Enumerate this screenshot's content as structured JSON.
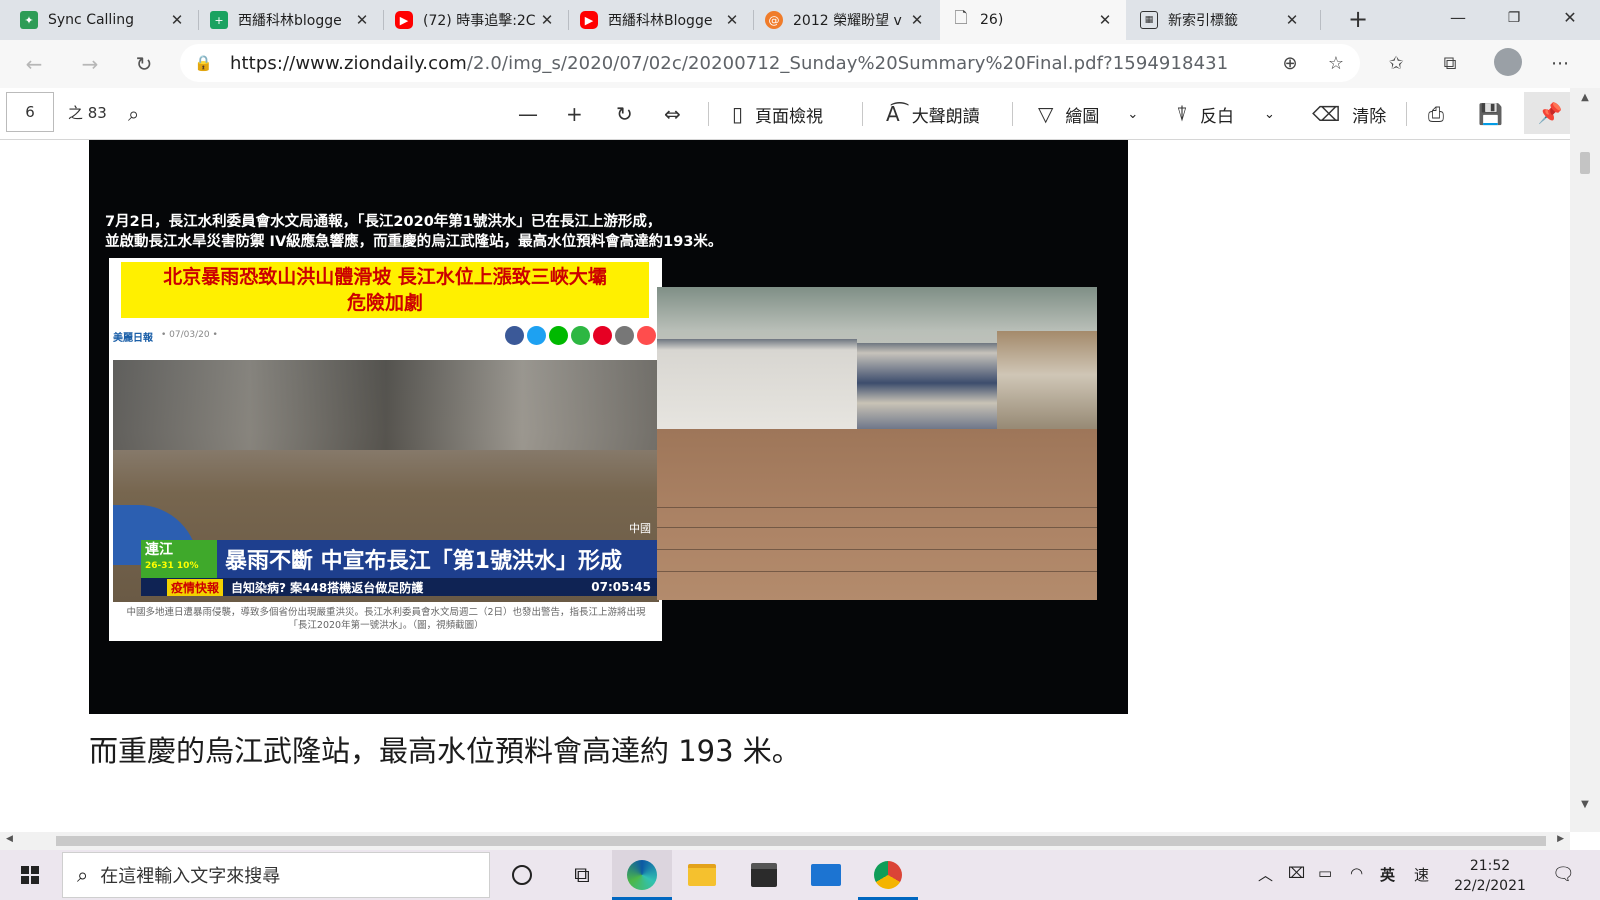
{
  "tabs": [
    {
      "title": "Sync Calling",
      "icon": "sync-calling-favicon",
      "color": "#2e9c56"
    },
    {
      "title": "西繙科林blogge",
      "icon": "blogger-plus-favicon",
      "color": "#1aa260"
    },
    {
      "title": "(72) 時事追擊:2C",
      "icon": "youtube-favicon",
      "color": "#ff0000"
    },
    {
      "title": "西繙科林Blogge",
      "icon": "youtube-favicon",
      "color": "#ff0000"
    },
    {
      "title": "2012 榮耀盼望 v",
      "icon": "orange-swirl-favicon",
      "color": "#f07c2a"
    },
    {
      "title": "26)",
      "icon": "document-icon",
      "color": "#555555"
    },
    {
      "title": "新索引標籤",
      "icon": "new-tab-icon",
      "color": "#333333"
    }
  ],
  "address": {
    "host": "https://www.ziondaily.com",
    "path": "/2.0/img_s/2020/07/02c/20200712_Sunday%20Summary%20Final.pdf?1594918431"
  },
  "pdf_toolbar": {
    "page": "6",
    "page_count": "之 83",
    "page_view": "頁面檢視",
    "read_aloud": "大聲朗讀",
    "draw": "繪圖",
    "highlight": "反白",
    "erase": "清除"
  },
  "document": {
    "caption_line1": "7月2日，長江水利委員會水文局通報，「長江2020年第1號洪水」已在長江上游形成，",
    "caption_line2": "並啟動長江水旱災害防禦 IV級應急響應，而重慶的烏江武隆站，最高水位預料會高達約193米。",
    "headline_line1": "北京暴雨恐致山洪山體滑坡  長江水位上漲致三峽大壩",
    "headline_line2": "危險加劇",
    "byline": "美麗日報",
    "bydate": "• 07/03/20 •",
    "ticker_location": "連江",
    "ticker_weather": "26-31  10%",
    "ticker_main": "暴雨不斷 中宣布長江「第1號洪水」形成",
    "ticker_tag": "疫情快報",
    "ticker_sub": "自知染病? 案448搭機返台做足防護",
    "ticker_time": "07:05:45",
    "ticker_watermark": "中國",
    "summary": "中國多地連日遭暴雨侵襲，導致多個省份出現嚴重洪災。長江水利委員會水文局週二（2日）也發出警告，指長江上游將出現「長江2020年第一號洪水」。（圖，視頻截圖）",
    "body_text": "而重慶的烏江武隆站，最高水位預料會高達約 193 米。"
  },
  "taskbar": {
    "search_placeholder": "在這裡輸入文字來搜尋",
    "ime_lang": "英",
    "ime_mode": "速",
    "time": "21:52",
    "date": "22/2/2021"
  }
}
